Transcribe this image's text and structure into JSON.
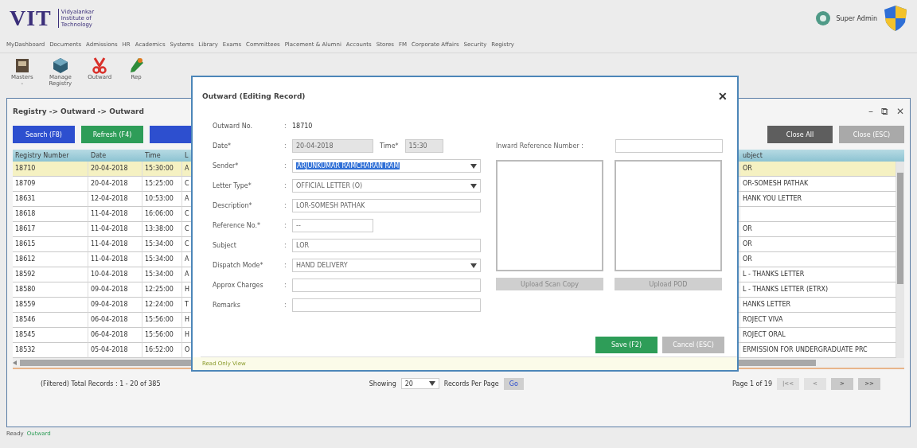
{
  "header": {
    "logo": "VIT",
    "logo_subtitle": [
      "Vidyalankar",
      "Institute of",
      "Technology"
    ],
    "user": "Super Admin"
  },
  "menu": [
    "MyDashboard",
    "Documents",
    "Admissions",
    "HR",
    "Academics",
    "Systems",
    "Library",
    "Exams",
    "Committees",
    "Placement & Alumni",
    "Accounts",
    "Stores",
    "FM",
    "Corporate Affairs",
    "Security",
    "Registry"
  ],
  "ribbon": [
    {
      "kind": "box",
      "lines": [
        "Masters",
        "-"
      ]
    },
    {
      "kind": "cube",
      "lines": [
        "Manage",
        "Registry"
      ]
    },
    {
      "kind": "scissors",
      "lines": [
        "Outward"
      ]
    },
    {
      "kind": "tool",
      "lines": [
        "Rep"
      ]
    }
  ],
  "panel": {
    "breadcrumb": "Registry -> Outward -> Outward",
    "window_controls": [
      "–",
      "⧉",
      "✕"
    ],
    "buttons": [
      {
        "label": "Search (F8)",
        "kind": "primary"
      },
      {
        "label": "Refresh (F4)",
        "kind": "success"
      },
      {
        "kind": "primary"
      }
    ],
    "right_buttons": [
      {
        "label": "Close All",
        "kind": "dark"
      },
      {
        "label": "Close (ESC)",
        "kind": "muted"
      }
    ],
    "table": {
      "columns": [
        "Registry Number",
        "Date",
        "Time",
        "L",
        "ubject"
      ],
      "rows": [
        {
          "cells": [
            "18710",
            "20-04-2018",
            "15:30:00",
            "A",
            "OR"
          ],
          "selected": true
        },
        {
          "cells": [
            "18709",
            "20-04-2018",
            "15:25:00",
            "C",
            "OR-SOMESH PATHAK"
          ],
          "selected": false
        },
        {
          "cells": [
            "18631",
            "12-04-2018",
            "10:53:00",
            "A",
            "HANK YOU LETTER"
          ],
          "selected": false
        },
        {
          "cells": [
            "18618",
            "11-04-2018",
            "16:06:00",
            "C",
            ""
          ],
          "selected": false
        },
        {
          "cells": [
            "18617",
            "11-04-2018",
            "13:38:00",
            "C",
            "OR"
          ],
          "selected": false
        },
        {
          "cells": [
            "18615",
            "11-04-2018",
            "15:34:00",
            "C",
            "OR"
          ],
          "selected": false
        },
        {
          "cells": [
            "18612",
            "11-04-2018",
            "15:34:00",
            "A",
            "OR"
          ],
          "selected": false
        },
        {
          "cells": [
            "18592",
            "10-04-2018",
            "15:34:00",
            "A",
            "L - THANKS LETTER"
          ],
          "selected": false
        },
        {
          "cells": [
            "18580",
            "09-04-2018",
            "12:25:00",
            "H",
            "L - THANKS LETTER (ETRX)"
          ],
          "selected": false
        },
        {
          "cells": [
            "18559",
            "09-04-2018",
            "12:24:00",
            "T",
            "HANKS LETTER"
          ],
          "selected": false
        },
        {
          "cells": [
            "18546",
            "06-04-2018",
            "15:56:00",
            "H",
            "ROJECT VIVA"
          ],
          "selected": false
        },
        {
          "cells": [
            "18545",
            "06-04-2018",
            "15:56:00",
            "H",
            "ROJECT ORAL"
          ],
          "selected": false
        },
        {
          "cells": [
            "18532",
            "05-04-2018",
            "16:52:00",
            "O",
            "ERMISSION FOR UNDERGRADUATE PRC"
          ],
          "selected": false
        }
      ]
    },
    "footer": {
      "summary": "(Filtered) Total Records : 1 - 20 of 385",
      "showing": "Showing",
      "per_page": "20",
      "per_page_label": "Records Per Page",
      "go": "Go",
      "page_info": "Page 1 of 19",
      "pager": [
        {
          "label": "|<<",
          "disabled": true
        },
        {
          "label": "<",
          "disabled": true
        },
        {
          "label": ">",
          "disabled": false
        },
        {
          "label": ">>",
          "disabled": false
        }
      ]
    }
  },
  "dialog": {
    "title": "Outward (Editing Record)",
    "close": "✕",
    "fields": [
      {
        "kind": "static",
        "label": "Outward No.",
        "colon": ":",
        "value": "18710"
      },
      {
        "kind": "datetime",
        "label": "Date*",
        "colon": ":",
        "value": "20-04-2018",
        "time_label": "Time*",
        "time_value": "15:30"
      },
      {
        "kind": "select",
        "label": "Sender*",
        "colon": ":",
        "value": "ARJUNKUMAR RAMCHARAN RAM",
        "highlighted": true
      },
      {
        "kind": "select",
        "label": "Letter Type*",
        "colon": ":",
        "value": "OFFICIAL LETTER (O)",
        "highlighted": false
      },
      {
        "kind": "text",
        "label": "Description*",
        "colon": ":",
        "value": "LOR-SOMESH PATHAK"
      },
      {
        "kind": "short",
        "label": "Reference No.*",
        "colon": ":",
        "value": "--"
      },
      {
        "kind": "text",
        "label": "Subject",
        "colon": ":",
        "value": "LOR"
      },
      {
        "kind": "select",
        "label": "Dispatch Mode*",
        "colon": ":",
        "value": "HAND DELIVERY",
        "highlighted": false
      },
      {
        "kind": "text",
        "label": "Approx Charges",
        "colon": ":"
      },
      {
        "kind": "text",
        "label": "Remarks",
        "colon": ":"
      }
    ],
    "inward_label": "Inward Reference Number :",
    "uploads": [
      "Upload Scan Copy",
      "Upload POD"
    ],
    "actions": [
      {
        "label": "Save (F2)",
        "kind": "success",
        "disabled": false
      },
      {
        "label": "Cancel (ESC)",
        "kind": "neutral",
        "disabled": true
      }
    ],
    "note": "Read Only View"
  },
  "status": [
    "Ready",
    "Outward"
  ]
}
